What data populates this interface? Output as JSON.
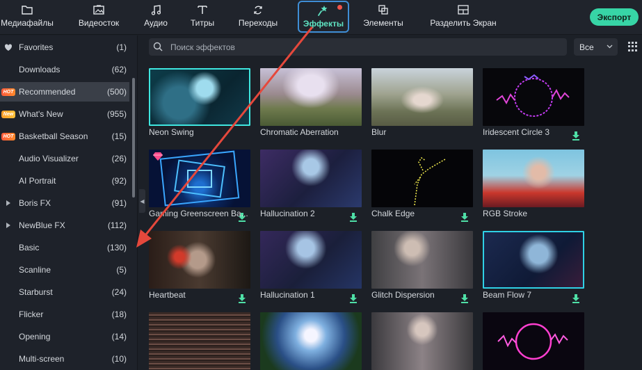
{
  "toolbar": {
    "tabs": [
      {
        "label": "Медиафайлы",
        "icon": "folder-icon"
      },
      {
        "label": "Видеосток",
        "icon": "stock-image-icon"
      },
      {
        "label": "Аудио",
        "icon": "music-note-icon"
      },
      {
        "label": "Титры",
        "icon": "text-icon"
      },
      {
        "label": "Переходы",
        "icon": "transition-icon"
      },
      {
        "label": "Эффекты",
        "icon": "magic-star-icon",
        "active": true,
        "has_notification": true
      },
      {
        "label": "Элементы",
        "icon": "elements-icon"
      },
      {
        "label": "Разделить Экран",
        "icon": "split-screen-icon"
      }
    ],
    "export_label": "Экспорт"
  },
  "sidebar": {
    "items": [
      {
        "name": "Favorites",
        "count": "(1)",
        "lead": "heart-icon"
      },
      {
        "name": "Downloads",
        "count": "(62)"
      },
      {
        "name": "Recommended",
        "count": "(500)",
        "tag": "HOT",
        "selected": true
      },
      {
        "name": "What's New",
        "count": "(955)",
        "tag": "New"
      },
      {
        "name": "Basketball Season",
        "count": "(15)",
        "tag": "HOT"
      },
      {
        "name": "Audio Visualizer",
        "count": "(26)"
      },
      {
        "name": "AI Portrait",
        "count": "(92)"
      },
      {
        "name": "Boris FX",
        "count": "(91)",
        "lead": "expand-arrow-icon"
      },
      {
        "name": "NewBlue FX",
        "count": "(112)",
        "lead": "expand-arrow-icon"
      },
      {
        "name": "Basic",
        "count": "(130)"
      },
      {
        "name": "Scanline",
        "count": "(5)"
      },
      {
        "name": "Starburst",
        "count": "(24)"
      },
      {
        "name": "Flicker",
        "count": "(18)"
      },
      {
        "name": "Opening",
        "count": "(14)"
      },
      {
        "name": "Multi-screen",
        "count": "(10)"
      }
    ]
  },
  "search": {
    "placeholder": "Поиск эффектов",
    "value": ""
  },
  "filter": {
    "selected": "Все"
  },
  "effects": [
    {
      "title": "Neon Swing",
      "download": false
    },
    {
      "title": "Chromatic Aberration",
      "download": false
    },
    {
      "title": "Blur",
      "download": false
    },
    {
      "title": "Iridescent Circle 3",
      "download": true
    },
    {
      "title": "Gaming Greenscreen Ba...",
      "download": true,
      "premium": true
    },
    {
      "title": "Hallucination 2",
      "download": true
    },
    {
      "title": "Chalk Edge",
      "download": true
    },
    {
      "title": "RGB Stroke",
      "download": true
    },
    {
      "title": "Heartbeat",
      "download": true
    },
    {
      "title": "Hallucination 1",
      "download": true
    },
    {
      "title": "Glitch Dispersion",
      "download": true
    },
    {
      "title": "Beam Flow 7",
      "download": true
    },
    {
      "title": "",
      "download": true
    },
    {
      "title": "",
      "download": true
    },
    {
      "title": "",
      "download": true
    },
    {
      "title": "",
      "download": true
    }
  ],
  "colors": {
    "accent": "#5fe3c2",
    "export": "#37d5a6",
    "active_tab_border": "#3f8ed6",
    "annotation_arrow": "#e5483c"
  }
}
